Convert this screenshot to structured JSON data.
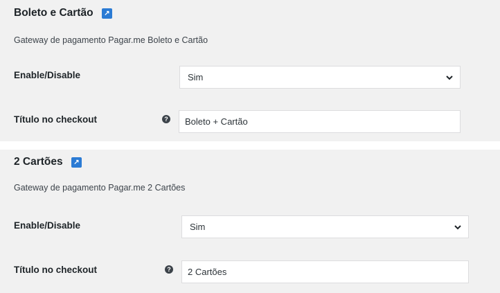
{
  "sections": [
    {
      "title": "Boleto e Cartão",
      "badge_icon": "external-link-icon",
      "description": "Gateway de pagamento Pagar.me Boleto e Cartão",
      "enable_label": "Enable/Disable",
      "enable_value": "Sim",
      "checkout_label": "Título no checkout",
      "checkout_value": "Boleto + Cartão"
    },
    {
      "title": "2 Cartões",
      "badge_icon": "external-link-icon",
      "description": "Gateway de pagamento Pagar.me 2 Cartões",
      "enable_label": "Enable/Disable",
      "enable_value": "Sim",
      "checkout_label": "Título no checkout",
      "checkout_value": "2 Cartões"
    }
  ],
  "colors": {
    "section_bg": "#f1f1f1",
    "badge": "#2b7bd4",
    "help_icon": "#3c434a"
  }
}
